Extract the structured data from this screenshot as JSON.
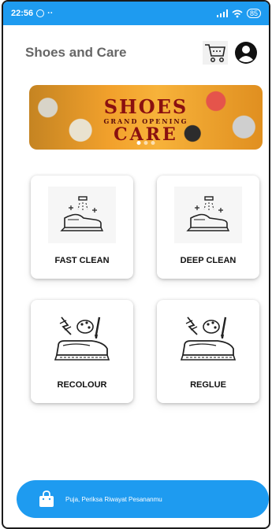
{
  "status_bar": {
    "time": "22:56",
    "dots": "··",
    "battery": "85"
  },
  "header": {
    "title": "Shoes and Care"
  },
  "banner": {
    "line1": "SHOES",
    "line2": "GRAND OPENING",
    "line3": "CARE",
    "page_count": 3,
    "active_page": 1
  },
  "services": [
    {
      "label": "FAST CLEAN",
      "icon": "shoe-spray-icon"
    },
    {
      "label": "DEEP CLEAN",
      "icon": "shoe-spray-icon"
    },
    {
      "label": "RECOLOUR",
      "icon": "slip-on-palette-icon"
    },
    {
      "label": "REGLUE",
      "icon": "slip-on-palette-icon"
    }
  ],
  "bottom_bar": {
    "text": "Puja, Periksa Riwayat Pesananmu",
    "icon": "shopping-bag-icon"
  },
  "colors": {
    "accent": "#1e9bf0"
  }
}
